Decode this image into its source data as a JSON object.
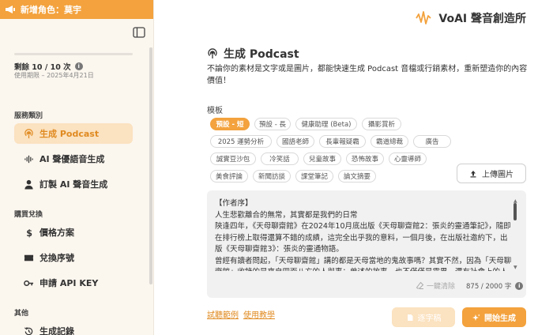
{
  "topbar": {
    "label": "新增角色：莫宇",
    "icon": "megaphone-icon"
  },
  "sidebar": {
    "quota_text": "剩餘 10 / 10 次",
    "quota_fraction": 0.0,
    "expiry_text": "使用期限 – 2025年4月21日",
    "sections": [
      {
        "label": "服務類別"
      },
      {
        "label": "購買兌換"
      },
      {
        "label": "其他"
      }
    ],
    "items": [
      {
        "label": "生成 Podcast",
        "icon": "podcast-icon",
        "active": true
      },
      {
        "label": "AI 聲優語音生成",
        "icon": "waveform-icon",
        "active": false
      },
      {
        "label": "訂製 AI 聲音生成",
        "icon": "user-icon",
        "active": false
      },
      {
        "label": "價格方案",
        "icon": "dollar-icon",
        "active": false
      },
      {
        "label": "兌換序號",
        "icon": "ticket-icon",
        "active": false
      },
      {
        "label": "申請 API KEY",
        "icon": "key-icon",
        "active": false
      },
      {
        "label": "生成記錄",
        "icon": "history-icon",
        "active": false
      }
    ]
  },
  "brand": {
    "name": "VoAI 聲音創造所",
    "accent": "#f3a23d"
  },
  "main": {
    "title": "生成 Podcast",
    "description": "不論你的素材是文字或是圖片，都能快速生成 Podcast 音檔或行銷素材，重新塑造你的內容價值！",
    "template_label": "模板",
    "templates": [
      {
        "label": "預設 - 短",
        "active": true
      },
      {
        "label": "預設 - 長"
      },
      {
        "label": "健康助理 (Beta)"
      },
      {
        "label": "攝影賞析"
      },
      {
        "label": "2025 運勢分析"
      },
      {
        "label": "國語老師"
      },
      {
        "label": "長輩報疑霸"
      },
      {
        "label": "霸道總裁"
      },
      {
        "label": "廣告"
      },
      {
        "label": "誠實豆沙包"
      },
      {
        "label": "冷笑話"
      },
      {
        "label": "兒童故事"
      },
      {
        "label": "恐怖故事"
      },
      {
        "label": "心靈導師"
      },
      {
        "label": "美食評論"
      },
      {
        "label": "新聞訪談"
      },
      {
        "label": "課堂筆記"
      },
      {
        "label": "論文摘要"
      }
    ],
    "upload_label": "上傳圖片",
    "text_lines": [
      "【作者序】",
      "人生悲歡離合的無常，其實都是我們的日常",
      "陝逢四年，《天母聊齋館》在2024年10月底出版《天母聊齋館2：張炎的靈通筆記》，隨即在排行榜上取得還算不錯的成績，這完全出乎我的意料，一個月後，在出版社邀約下，出版《天母聊齋館3》：張炎的靈通物語。",
      "曾經有讀者問起，「天母聊齋館」講的都是天母當地的鬼故事嗎？其實不然，因為「天母聊齋館」收錄的是來自四面八方的人與事；曾述的故事，也不僅僅是靈異，還有社會上的人情冷暖。"
    ],
    "clear_label": "一鍵清除",
    "char_count": "875 / 2000 字",
    "link_example": "試聽範例",
    "link_tutorial": "使用教學",
    "draft_label": "逐字稿",
    "start_label": "開始生成"
  }
}
